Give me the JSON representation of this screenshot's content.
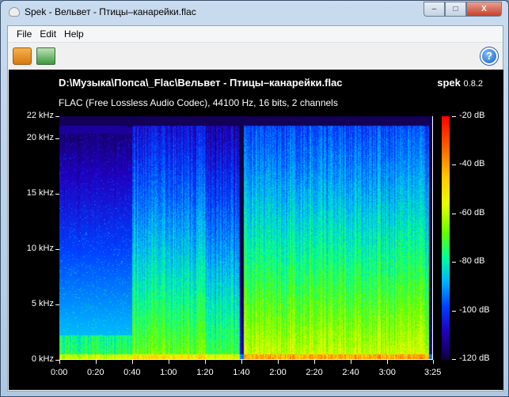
{
  "window": {
    "title": "Spek - Вельвет - Птицы–канарейки.flac",
    "min": "–",
    "max": "□",
    "close": "X"
  },
  "menu": [
    "File",
    "Edit",
    "Help"
  ],
  "toolbar": {
    "help_glyph": "?"
  },
  "header": {
    "file": "D:\\Музыка\\Попса\\_Flac\\Вельвет - Птицы–канарейки.flac",
    "app": "spek",
    "version": "0.8.2",
    "info": "FLAC (Free Lossless Audio Codec), 44100 Hz, 16 bits, 2 channels"
  },
  "chart_data": {
    "type": "heatmap",
    "title": "D:\\Музыка\\Попса\\_Flac\\Вельвет - Птицы–канарейки.flac",
    "y_ticks": [
      "22 kHz",
      "20 kHz",
      "15 kHz",
      "10 kHz",
      "5 kHz",
      "0 kHz"
    ],
    "y_values": [
      22,
      20,
      15,
      10,
      5,
      0
    ],
    "x_ticks": [
      "0:00",
      "0:20",
      "0:40",
      "1:00",
      "1:20",
      "1:40",
      "2:00",
      "2:20",
      "2:40",
      "3:00",
      "3:25"
    ],
    "x_values": [
      0,
      20,
      40,
      60,
      80,
      100,
      120,
      140,
      160,
      180,
      205
    ],
    "xlim": [
      0,
      205
    ],
    "ylim": [
      0,
      22
    ],
    "colorbar_ticks": [
      "-20 dB",
      "-40 dB",
      "-60 dB",
      "-80 dB",
      "-100 dB",
      "-120 dB"
    ],
    "colorbar_values": [
      -20,
      -40,
      -60,
      -80,
      -100,
      -120
    ]
  }
}
